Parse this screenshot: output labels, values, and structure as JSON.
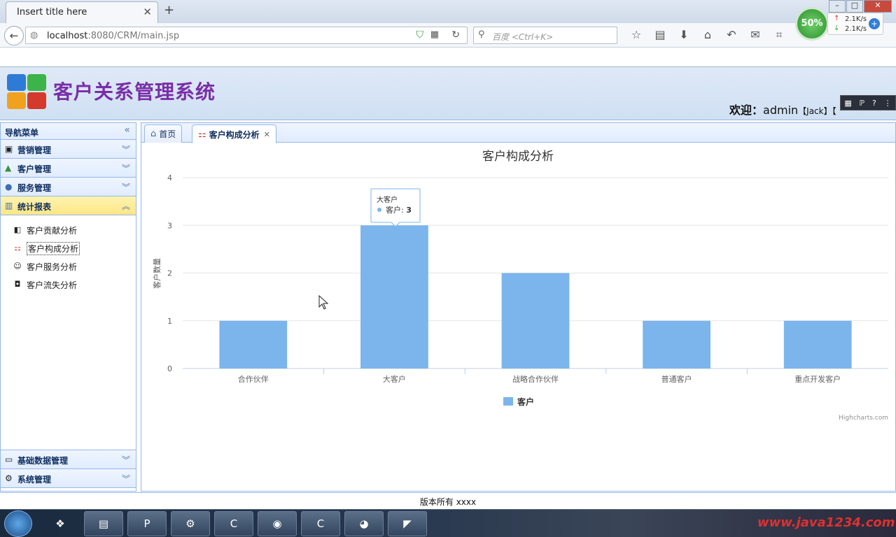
{
  "browser": {
    "tab_title": "Insert title here",
    "url_host": "localhost",
    "url_rest": ":8080/CRM/main.jsp",
    "search_placeholder": "百度 <Ctrl+K>"
  },
  "speed_widget": {
    "percent": "50%",
    "up": "2.1K/s",
    "down": "2.1K/s"
  },
  "header": {
    "title": "客户关系管理系统",
    "welcome_label": "欢迎：",
    "user": "admin",
    "role": "【Jack】",
    "bracket": "【"
  },
  "sidebar": {
    "title": "导航菜单",
    "sections": [
      {
        "label": "营销管理"
      },
      {
        "label": "客户管理"
      },
      {
        "label": "服务管理"
      },
      {
        "label": "统计报表"
      }
    ],
    "sub_items": [
      {
        "label": "客户贡献分析"
      },
      {
        "label": "客户构成分析"
      },
      {
        "label": "客户服务分析"
      },
      {
        "label": "客户流失分析"
      }
    ],
    "bottom_sections": [
      {
        "label": "基础数据管理"
      },
      {
        "label": "系统管理"
      }
    ]
  },
  "tabs": [
    {
      "label": "首页"
    },
    {
      "label": "客户构成分析"
    }
  ],
  "chart_data": {
    "type": "bar",
    "title": "客户构成分析",
    "ylabel": "客户数量",
    "categories": [
      "合作伙伴",
      "大客户",
      "战略合作伙伴",
      "普通客户",
      "重点开发客户"
    ],
    "series": [
      {
        "name": "客户",
        "values": [
          1,
          3,
          2,
          1,
          1
        ],
        "color": "#7cb5ec"
      }
    ],
    "ylim": [
      0,
      4
    ],
    "yticks": [
      0,
      1,
      2,
      3,
      4
    ],
    "grid": true,
    "legend": "bottom-center",
    "tooltip": {
      "category": "大客户",
      "series": "客户",
      "value": "3"
    },
    "credits": "Highcharts.com"
  },
  "footer": {
    "text": "版本所有 xxxx"
  },
  "taskbar": {
    "watermark": "www.java1234.com"
  }
}
